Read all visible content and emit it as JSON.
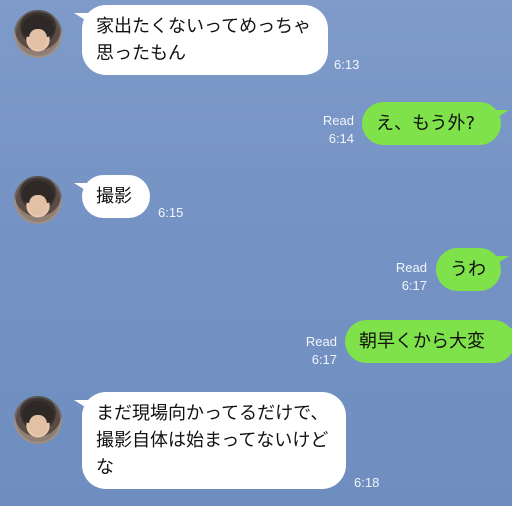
{
  "messages": [
    {
      "side": "in",
      "text": "家出たくないってめっちゃ\n思ったもん",
      "time": "6:13"
    },
    {
      "side": "out",
      "text": "え、もう外?",
      "read": "Read",
      "time": "6:14"
    },
    {
      "side": "in",
      "text": "撮影",
      "time": "6:15"
    },
    {
      "side": "out",
      "text": "うわ",
      "read": "Read",
      "time": "6:17"
    },
    {
      "side": "out",
      "text": "朝早くから大変",
      "read": "Read",
      "time": "6:17"
    },
    {
      "side": "in",
      "text": "まだ現場向かってるだけで、\n撮影自体は始まってないけど\nな",
      "time": "6:18"
    }
  ],
  "colors": {
    "incoming_bubble": "#ffffff",
    "outgoing_bubble": "#7fe24a",
    "background": "#7593c4"
  }
}
